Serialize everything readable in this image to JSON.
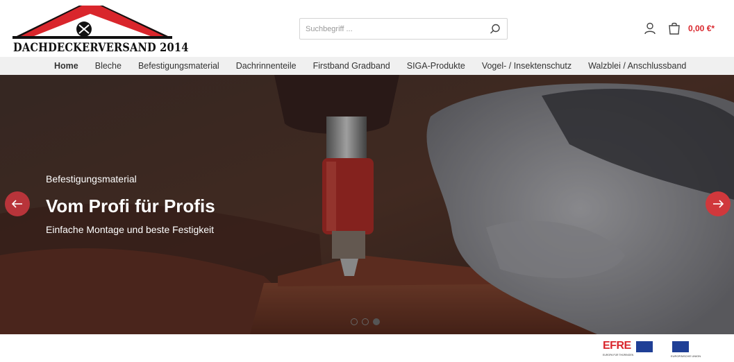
{
  "header": {
    "logo_text": "DACHDECKERVERSAND 2014",
    "search_placeholder": "Suchbegriff ...",
    "cart_total": "0,00 €*"
  },
  "nav": {
    "items": [
      {
        "label": "Home",
        "active": true
      },
      {
        "label": "Bleche"
      },
      {
        "label": "Befestigungsmaterial"
      },
      {
        "label": "Dachrinnenteile"
      },
      {
        "label": "Firstband Gradband"
      },
      {
        "label": "SIGA-Produkte"
      },
      {
        "label": "Vogel- / Insektenschutz"
      },
      {
        "label": "Walzblei / Anschlussband"
      }
    ]
  },
  "hero": {
    "subtitle": "Befestigungsmaterial",
    "title": "Vom Profi für Profis",
    "description": "Einfache Montage und beste Festigkeit",
    "slides": 3,
    "active_slide": 3
  },
  "footer": {
    "efre_label": "EFRE",
    "efre_caption": "EUROPA FÜR THÜRINGEN",
    "eu_caption": "EUROPÄISCHE UNION"
  },
  "colors": {
    "accent": "#d9262c",
    "nav_bg": "#f0f0f0"
  },
  "icons": {
    "search": "search-icon",
    "account": "user-icon",
    "cart": "shopping-bag-icon",
    "prev": "arrow-left-icon",
    "next": "arrow-right-icon"
  }
}
